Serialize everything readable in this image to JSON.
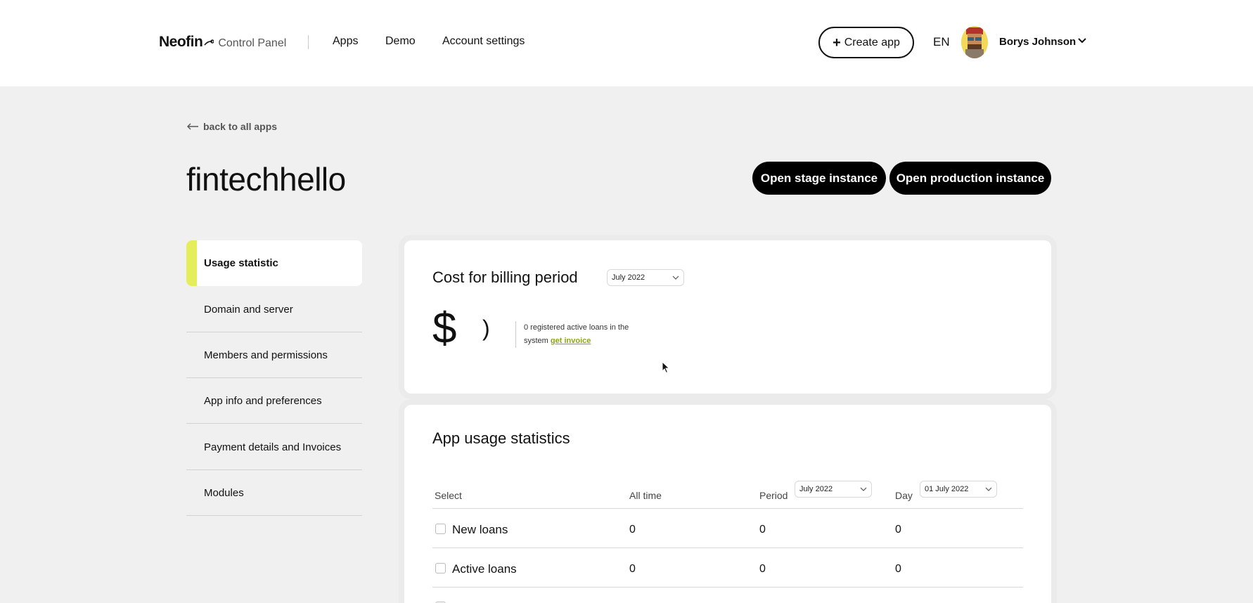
{
  "header": {
    "logo": "Neofin",
    "logo_sub": "Control Panel",
    "nav": [
      "Apps",
      "Demo",
      "Account settings"
    ],
    "create_label": "Create app",
    "lang": "EN",
    "username": "Borys Johnson"
  },
  "back_label": "back to all apps",
  "title": "fintechhello",
  "buttons": {
    "stage": "Open stage instance",
    "production": "Open production instance"
  },
  "sidebar": {
    "items": [
      {
        "label": "Usage statistic",
        "active": true
      },
      {
        "label": "Domain and server"
      },
      {
        "label": "Members and permissions"
      },
      {
        "label": "App info and preferences"
      },
      {
        "label": "Payment details and Invoices"
      },
      {
        "label": "Modules"
      }
    ]
  },
  "billing": {
    "title": "Cost for billing period",
    "period": "July 2022",
    "currency": "$",
    "paren": ")",
    "note": "0 registered active loans in the system",
    "invoice_link": "get invoice"
  },
  "usage": {
    "title": "App usage statistics",
    "columns": {
      "select": "Select",
      "all_time": "All time",
      "period": "Period",
      "day": "Day"
    },
    "period_value": "July 2022",
    "day_value": "01 July 2022",
    "rows": [
      {
        "label": "New loans",
        "all_time": "0",
        "period": "0",
        "day": "0"
      },
      {
        "label": "Active loans",
        "all_time": "0",
        "period": "0",
        "day": "0"
      }
    ]
  },
  "colors": {
    "accent": "#e4ee5a",
    "link": "#8ba614",
    "primary": "#000000",
    "background": "#f0f0f0"
  }
}
